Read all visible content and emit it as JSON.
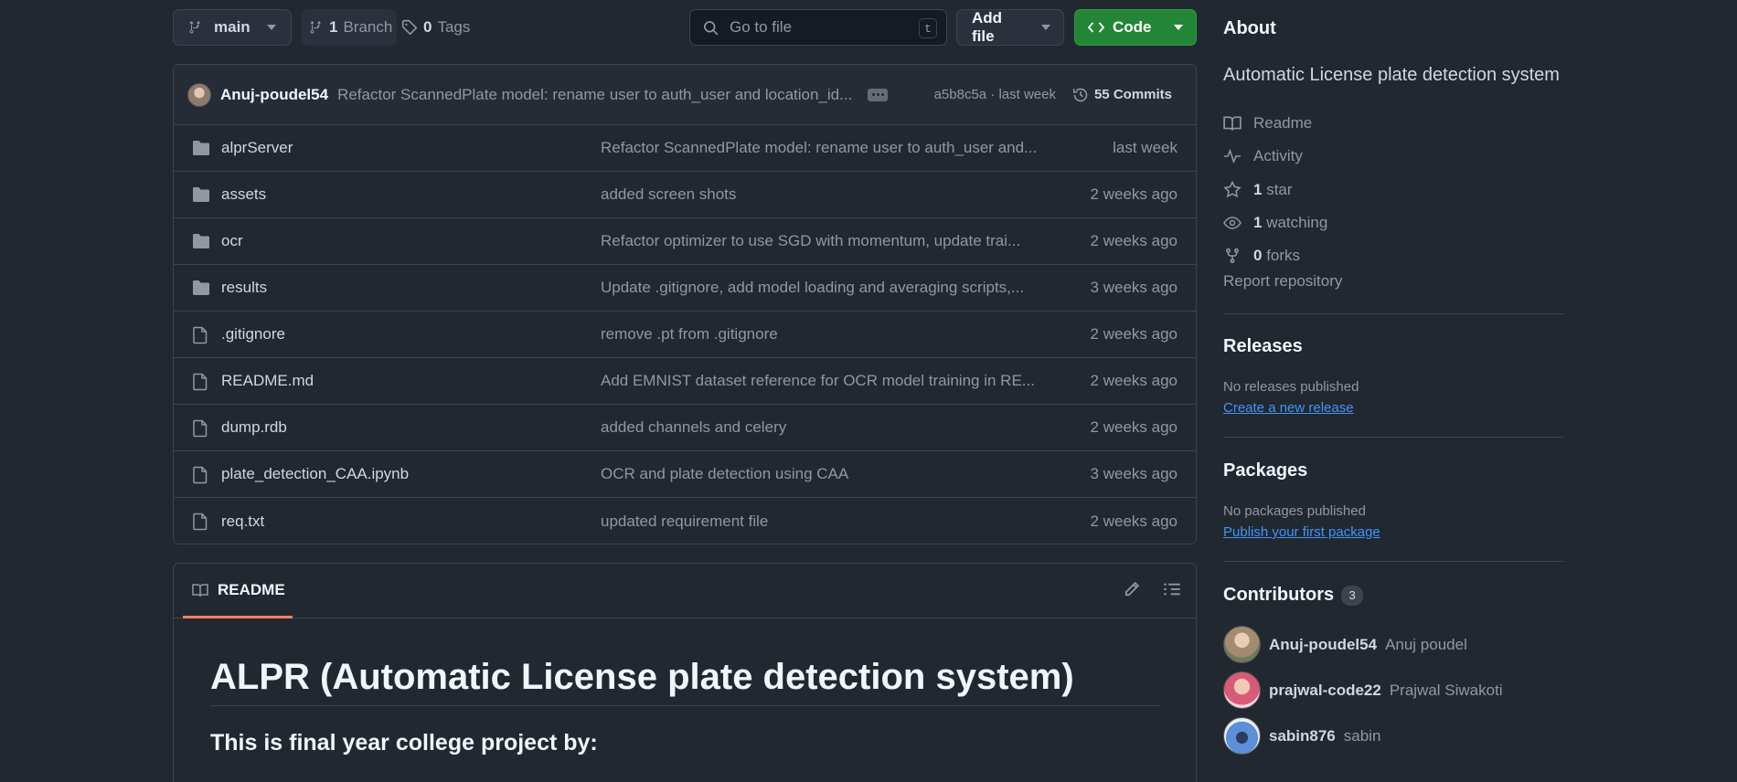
{
  "toolbar": {
    "branch_name": "main",
    "branches_count": "1",
    "branches_label": "Branch",
    "tags_count": "0",
    "tags_label": "Tags",
    "goto_placeholder": "Go to file",
    "goto_shortcut": "t",
    "add_file_label": "Add file",
    "code_label": "Code"
  },
  "latest_commit": {
    "author": "Anuj-poudel54",
    "message": "Refactor ScannedPlate model: rename user to auth_user and location_id...",
    "sha_time": "a5b8c5a · last week",
    "commits_label": "55 Commits"
  },
  "files": [
    {
      "name": "alprServer",
      "type": "folder",
      "message": "Refactor ScannedPlate model: rename user to auth_user and...",
      "time": "last week"
    },
    {
      "name": "assets",
      "type": "folder",
      "message": "added screen shots",
      "time": "2 weeks ago"
    },
    {
      "name": "ocr",
      "type": "folder",
      "message": "Refactor optimizer to use SGD with momentum, update trai...",
      "time": "2 weeks ago"
    },
    {
      "name": "results",
      "type": "folder",
      "message": "Update .gitignore, add model loading and averaging scripts,...",
      "time": "3 weeks ago"
    },
    {
      "name": ".gitignore",
      "type": "file",
      "message": "remove .pt from .gitignore",
      "time": "2 weeks ago"
    },
    {
      "name": "README.md",
      "type": "file",
      "message": "Add EMNIST dataset reference for OCR model training in RE...",
      "time": "2 weeks ago"
    },
    {
      "name": "dump.rdb",
      "type": "file",
      "message": "added channels and celery",
      "time": "2 weeks ago"
    },
    {
      "name": "plate_detection_CAA.ipynb",
      "type": "file",
      "message": "OCR and plate detection using CAA",
      "time": "3 weeks ago"
    },
    {
      "name": "req.txt",
      "type": "file",
      "message": "updated requirement file",
      "time": "2 weeks ago"
    }
  ],
  "readme": {
    "tab_label": "README",
    "heading": "ALPR (Automatic License plate detection system)",
    "intro": "This is final year college project by:"
  },
  "about": {
    "title": "About",
    "description": "Automatic License plate detection system",
    "readme": "Readme",
    "activity": "Activity",
    "stars_count": "1",
    "stars_label": "star",
    "watching_count": "1",
    "watching_label": "watching",
    "forks_count": "0",
    "forks_label": "forks",
    "report": "Report repository"
  },
  "releases": {
    "title": "Releases",
    "none": "No releases published",
    "link": "Create a new release"
  },
  "packages": {
    "title": "Packages",
    "none": "No packages published",
    "link": "Publish your first package"
  },
  "contributors": {
    "title": "Contributors",
    "count": "3",
    "people": [
      {
        "login": "Anuj-poudel54",
        "name": "Anuj poudel"
      },
      {
        "login": "prajwal-code22",
        "name": "Prajwal Siwakoti"
      },
      {
        "login": "sabin876",
        "name": "sabin"
      }
    ]
  },
  "colors": {
    "background": "#212830",
    "accent_green": "#238636",
    "link_blue": "#4493f8",
    "readme_tab_underline": "#f78166"
  },
  "icons": {
    "folder": "folder-icon",
    "file": "file-icon"
  }
}
